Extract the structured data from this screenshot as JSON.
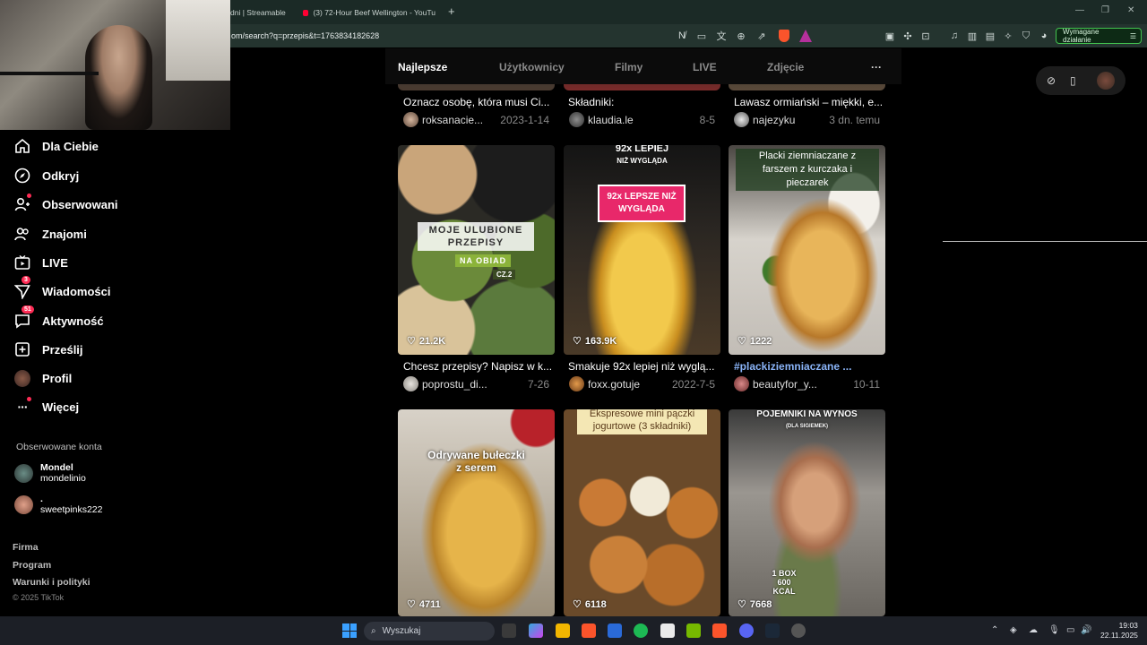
{
  "browser": {
    "tabs": [
      {
        "label": "dni | Streamable"
      },
      {
        "label": "(3) 72-Hour Beef Wellington - YouTu"
      }
    ],
    "url": "om/search?q=przepis&t=1763834182628",
    "extension_badge": "Wymagane działanie"
  },
  "sidebar": {
    "nav": [
      {
        "label": "Dla Ciebie",
        "icon": "home-icon"
      },
      {
        "label": "Odkryj",
        "icon": "compass-icon"
      },
      {
        "label": "Obserwowani",
        "icon": "following-icon"
      },
      {
        "label": "Znajomi",
        "icon": "friends-icon"
      },
      {
        "label": "LIVE",
        "icon": "live-icon"
      },
      {
        "label": "Wiadomości",
        "icon": "messages-icon",
        "badge": "3"
      },
      {
        "label": "Aktywność",
        "icon": "activity-icon",
        "badge": "51"
      },
      {
        "label": "Prześlij",
        "icon": "upload-icon"
      },
      {
        "label": "Profil",
        "icon": "profile-avatar"
      },
      {
        "label": "Więcej",
        "icon": "more-icon"
      }
    ],
    "followed_title": "Obserwowane konta",
    "followed": [
      {
        "name": "Mondel",
        "handle": "mondelinio"
      },
      {
        "name": ".",
        "handle": "sweetpinks222"
      }
    ],
    "footer": [
      "Firma",
      "Program",
      "Warunki i polityki"
    ],
    "copyright": "© 2025 TikTok"
  },
  "search_tabs": [
    "Najlepsze",
    "Użytkownicy",
    "Filmy",
    "LIVE",
    "Zdjęcie"
  ],
  "search_tabs_more": "···",
  "grid": {
    "row1": [
      {
        "caption": "Oznacz osobę, która musi Ci...",
        "user": "roksanacie...",
        "date": "2023-1-14"
      },
      {
        "caption": "Składniki:",
        "user": "klaudia.le",
        "date": "8-5"
      },
      {
        "caption": "Lawasz ormiański – miękki, e...",
        "user": "najezyku",
        "date": "3 dn. temu"
      }
    ],
    "row2": [
      {
        "likes": "21.2K",
        "caption": "Chcesz przepisy? Napisz w k...",
        "user": "poprostu_di...",
        "date": "7-26",
        "overlay": [
          "MOJE ULUBIONE",
          "PRZEPISY",
          "NA OBIAD",
          "CZ.2"
        ]
      },
      {
        "likes": "163.9K",
        "caption": "Smakuje 92x lepiej niż wyglą...",
        "user": "foxx.gotuje",
        "date": "2022-7-5",
        "overlay": [
          "92x LEPIEJ",
          "NIŻ WYGLĄDA",
          "92x LEPSZE NIŻ",
          "WYGLĄDA"
        ]
      },
      {
        "likes": "1222",
        "caption": "#plackiziemniaczane ...",
        "user": "beautyfor_y...",
        "date": "10-11",
        "overlay": [
          "Placki ziemniaczane z",
          "farszem z kurczaka i",
          "pieczarek"
        ]
      }
    ],
    "row3": [
      {
        "likes": "4711",
        "overlay": [
          "Odrywane bułeczki",
          "z serem"
        ]
      },
      {
        "likes": "6118",
        "overlay": [
          "Ekspresowe mini pączki",
          "jogurtowe (3 składniki)"
        ]
      },
      {
        "likes": "7668",
        "overlay": [
          "POJEMNIKI NA WYNOS",
          "(DLA SIGIEMEK)",
          "1 BOX",
          "600 KCAL"
        ]
      }
    ]
  },
  "taskbar": {
    "search_placeholder": "Wyszukaj",
    "time": "19:03",
    "date": "22.11.2025"
  }
}
